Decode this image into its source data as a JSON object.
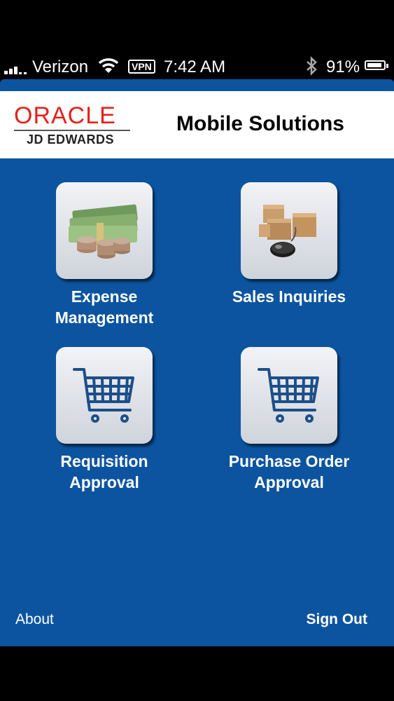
{
  "status_bar": {
    "carrier": "Verizon",
    "vpn": "VPN",
    "time": "7:42 AM",
    "battery": "91%",
    "battery_level": 0.91
  },
  "header": {
    "logo_brand": "ORACLE",
    "logo_sub": "JD EDWARDS",
    "title": "Mobile Solutions"
  },
  "tiles": [
    {
      "line1": "Expense",
      "line2": "Management",
      "icon": "money-icon"
    },
    {
      "line1": "Sales Inquiries",
      "line2": "",
      "icon": "boxes-mouse-icon"
    },
    {
      "line1": "Requisition",
      "line2": "Approval",
      "icon": "shopping-cart-icon"
    },
    {
      "line1": "Purchase Order",
      "line2": "Approval",
      "icon": "shopping-cart-icon"
    }
  ],
  "footer": {
    "about": "About",
    "sign_out": "Sign Out"
  },
  "colors": {
    "background": "#0c549f",
    "oracle_red": "#e4211c",
    "tile_face": "#e6e8ee"
  }
}
